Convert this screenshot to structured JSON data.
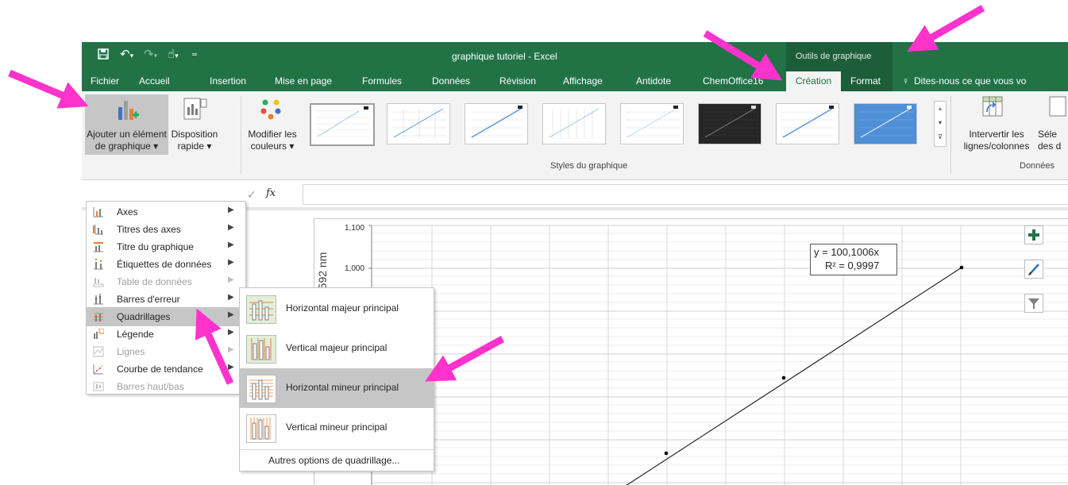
{
  "window": {
    "title": "graphique tutoriel - Excel",
    "context_label": "Outils de graphique"
  },
  "tabs": [
    "Fichier",
    "Accueil",
    "Insertion",
    "Mise en page",
    "Formules",
    "Données",
    "Révision",
    "Affichage",
    "Antidote",
    "ChemOffice16",
    "Création",
    "Format"
  ],
  "tell_me": "Dites-nous ce que vous vo",
  "ribbon": {
    "add_element_line1": "Ajouter un élément",
    "add_element_line2": "de graphique ▾",
    "layout_line1": "Disposition",
    "layout_line2": "rapide ▾",
    "colors_line1": "Modifier les",
    "colors_line2": "couleurs ▾",
    "styles_group": "Styles du graphique",
    "switch_line1": "Intervertir les",
    "switch_line2": "lignes/colonnes",
    "select_line1": "Séle",
    "select_line2": "des d",
    "data_group": "Données"
  },
  "formula": {
    "check": "✓",
    "fx": "fx"
  },
  "menu": {
    "items": [
      {
        "label": "Axes",
        "disabled": false
      },
      {
        "label": "Titres des axes",
        "disabled": false
      },
      {
        "label": "Titre du graphique",
        "disabled": false
      },
      {
        "label": "Étiquettes de données",
        "disabled": false
      },
      {
        "label": "Table de données",
        "disabled": true
      },
      {
        "label": "Barres d'erreur",
        "disabled": false
      },
      {
        "label": "Quadrillages",
        "disabled": false
      },
      {
        "label": "Légende",
        "disabled": false
      },
      {
        "label": "Lignes",
        "disabled": true
      },
      {
        "label": "Courbe de tendance",
        "disabled": false
      },
      {
        "label": "Barres haut/bas",
        "disabled": true
      }
    ]
  },
  "submenu": {
    "items": [
      "Horizontal majeur principal",
      "Vertical majeur principal",
      "Horizontal mineur principal",
      "Vertical mineur principal"
    ],
    "more": "Autres options de quadrillage..."
  },
  "chart": {
    "ylabel": "à 592 nm",
    "yticks": [
      "1,100",
      "1,000"
    ],
    "equation_line1": "y = 100,1006x",
    "equation_line2": "R² = 0,9997"
  },
  "colors": {
    "excel_green": "#217346",
    "arrow_magenta": "#ff33cc",
    "highlight": "#c6c6c6"
  }
}
